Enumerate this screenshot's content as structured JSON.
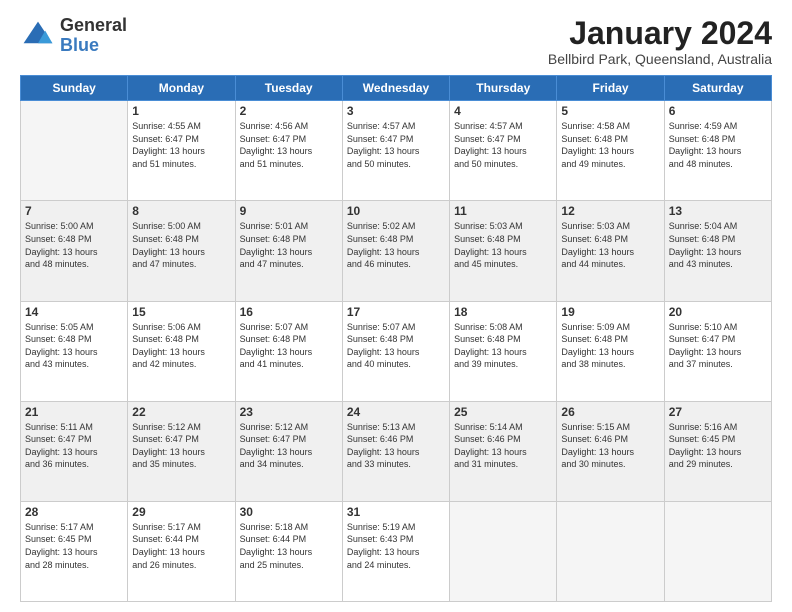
{
  "logo": {
    "general": "General",
    "blue": "Blue"
  },
  "header": {
    "month": "January 2024",
    "location": "Bellbird Park, Queensland, Australia"
  },
  "weekdays": [
    "Sunday",
    "Monday",
    "Tuesday",
    "Wednesday",
    "Thursday",
    "Friday",
    "Saturday"
  ],
  "weeks": [
    [
      {
        "day": "",
        "info": ""
      },
      {
        "day": "1",
        "info": "Sunrise: 4:55 AM\nSunset: 6:47 PM\nDaylight: 13 hours\nand 51 minutes."
      },
      {
        "day": "2",
        "info": "Sunrise: 4:56 AM\nSunset: 6:47 PM\nDaylight: 13 hours\nand 51 minutes."
      },
      {
        "day": "3",
        "info": "Sunrise: 4:57 AM\nSunset: 6:47 PM\nDaylight: 13 hours\nand 50 minutes."
      },
      {
        "day": "4",
        "info": "Sunrise: 4:57 AM\nSunset: 6:47 PM\nDaylight: 13 hours\nand 50 minutes."
      },
      {
        "day": "5",
        "info": "Sunrise: 4:58 AM\nSunset: 6:48 PM\nDaylight: 13 hours\nand 49 minutes."
      },
      {
        "day": "6",
        "info": "Sunrise: 4:59 AM\nSunset: 6:48 PM\nDaylight: 13 hours\nand 48 minutes."
      }
    ],
    [
      {
        "day": "7",
        "info": "Sunrise: 5:00 AM\nSunset: 6:48 PM\nDaylight: 13 hours\nand 48 minutes."
      },
      {
        "day": "8",
        "info": "Sunrise: 5:00 AM\nSunset: 6:48 PM\nDaylight: 13 hours\nand 47 minutes."
      },
      {
        "day": "9",
        "info": "Sunrise: 5:01 AM\nSunset: 6:48 PM\nDaylight: 13 hours\nand 47 minutes."
      },
      {
        "day": "10",
        "info": "Sunrise: 5:02 AM\nSunset: 6:48 PM\nDaylight: 13 hours\nand 46 minutes."
      },
      {
        "day": "11",
        "info": "Sunrise: 5:03 AM\nSunset: 6:48 PM\nDaylight: 13 hours\nand 45 minutes."
      },
      {
        "day": "12",
        "info": "Sunrise: 5:03 AM\nSunset: 6:48 PM\nDaylight: 13 hours\nand 44 minutes."
      },
      {
        "day": "13",
        "info": "Sunrise: 5:04 AM\nSunset: 6:48 PM\nDaylight: 13 hours\nand 43 minutes."
      }
    ],
    [
      {
        "day": "14",
        "info": "Sunrise: 5:05 AM\nSunset: 6:48 PM\nDaylight: 13 hours\nand 43 minutes."
      },
      {
        "day": "15",
        "info": "Sunrise: 5:06 AM\nSunset: 6:48 PM\nDaylight: 13 hours\nand 42 minutes."
      },
      {
        "day": "16",
        "info": "Sunrise: 5:07 AM\nSunset: 6:48 PM\nDaylight: 13 hours\nand 41 minutes."
      },
      {
        "day": "17",
        "info": "Sunrise: 5:07 AM\nSunset: 6:48 PM\nDaylight: 13 hours\nand 40 minutes."
      },
      {
        "day": "18",
        "info": "Sunrise: 5:08 AM\nSunset: 6:48 PM\nDaylight: 13 hours\nand 39 minutes."
      },
      {
        "day": "19",
        "info": "Sunrise: 5:09 AM\nSunset: 6:48 PM\nDaylight: 13 hours\nand 38 minutes."
      },
      {
        "day": "20",
        "info": "Sunrise: 5:10 AM\nSunset: 6:47 PM\nDaylight: 13 hours\nand 37 minutes."
      }
    ],
    [
      {
        "day": "21",
        "info": "Sunrise: 5:11 AM\nSunset: 6:47 PM\nDaylight: 13 hours\nand 36 minutes."
      },
      {
        "day": "22",
        "info": "Sunrise: 5:12 AM\nSunset: 6:47 PM\nDaylight: 13 hours\nand 35 minutes."
      },
      {
        "day": "23",
        "info": "Sunrise: 5:12 AM\nSunset: 6:47 PM\nDaylight: 13 hours\nand 34 minutes."
      },
      {
        "day": "24",
        "info": "Sunrise: 5:13 AM\nSunset: 6:46 PM\nDaylight: 13 hours\nand 33 minutes."
      },
      {
        "day": "25",
        "info": "Sunrise: 5:14 AM\nSunset: 6:46 PM\nDaylight: 13 hours\nand 31 minutes."
      },
      {
        "day": "26",
        "info": "Sunrise: 5:15 AM\nSunset: 6:46 PM\nDaylight: 13 hours\nand 30 minutes."
      },
      {
        "day": "27",
        "info": "Sunrise: 5:16 AM\nSunset: 6:45 PM\nDaylight: 13 hours\nand 29 minutes."
      }
    ],
    [
      {
        "day": "28",
        "info": "Sunrise: 5:17 AM\nSunset: 6:45 PM\nDaylight: 13 hours\nand 28 minutes."
      },
      {
        "day": "29",
        "info": "Sunrise: 5:17 AM\nSunset: 6:44 PM\nDaylight: 13 hours\nand 26 minutes."
      },
      {
        "day": "30",
        "info": "Sunrise: 5:18 AM\nSunset: 6:44 PM\nDaylight: 13 hours\nand 25 minutes."
      },
      {
        "day": "31",
        "info": "Sunrise: 5:19 AM\nSunset: 6:43 PM\nDaylight: 13 hours\nand 24 minutes."
      },
      {
        "day": "",
        "info": ""
      },
      {
        "day": "",
        "info": ""
      },
      {
        "day": "",
        "info": ""
      }
    ]
  ]
}
